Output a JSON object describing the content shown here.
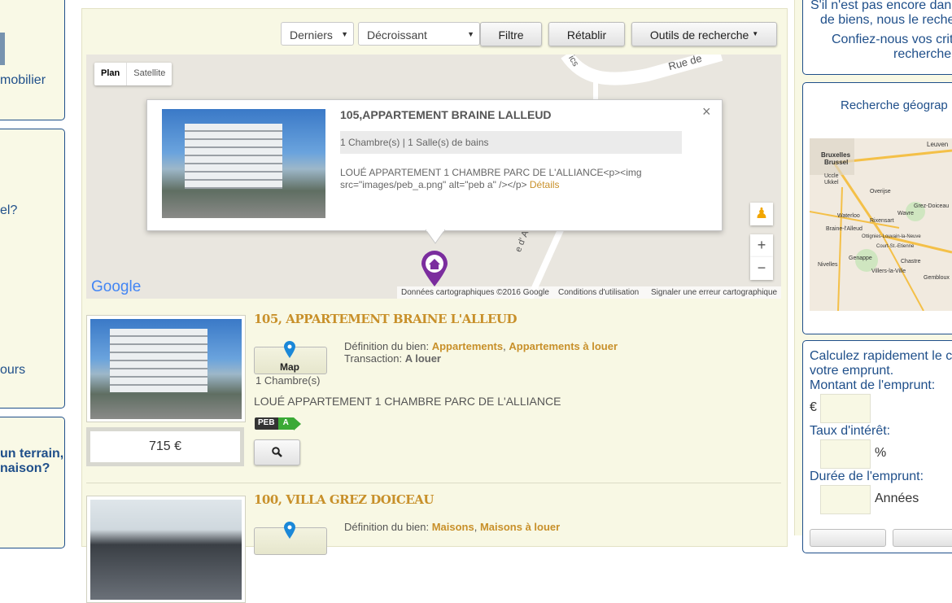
{
  "left_sidebar": {
    "link1": "mobilier",
    "link2": "el?",
    "link3": "ours",
    "heading_line1": "un terrain,",
    "heading_line2": "naison?"
  },
  "toolbar": {
    "sort_field": "Derniers",
    "sort_order": "Décroissant",
    "filter_label": "Filtre",
    "reset_label": "Rétablir",
    "tools_label": "Outils de recherche"
  },
  "map": {
    "type_plan": "Plan",
    "type_satellite": "Satellite",
    "street1": "Rue de",
    "street2": "ics",
    "street3": "e d' Autriche",
    "attribution": "Données cartographiques ©2016 Google",
    "terms": "Conditions d'utilisation",
    "report": "Signaler une erreur cartographique",
    "google_logo": "Google",
    "info": {
      "title": "105,APPARTEMENT BRAINE LALLEUD",
      "rooms": "1 Chambre(s) | 1 Salle(s) de bains",
      "desc_line1": "LOUÉ APPARTEMENT 1 CHAMBRE PARC DE L'ALLIANCE<p><img",
      "desc_line2": "src=\"images/peb_a.png\" alt=\"peb a\" /></p>",
      "details_link": "Détails",
      "close": "×"
    }
  },
  "listings": [
    {
      "title": "105, APPARTEMENT BRAINE L'ALLEUD",
      "map_label": "Map",
      "rooms": "1 Chambre(s)",
      "def_label": "Définition du bien:",
      "def_cat1": "Appartements",
      "def_sep": ",",
      "def_cat2": "Appartements à louer",
      "trans_label": "Transaction:",
      "trans_value": "A louer",
      "description": "LOUÉ APPARTEMENT 1 CHAMBRE PARC DE L'ALLIANCE",
      "peb_label": "PEB",
      "peb_grade": "A",
      "price": "715 €"
    },
    {
      "title": "100, VILLA GREZ DOICEAU",
      "def_label": "Définition du bien:",
      "def_cat1": "Maisons",
      "def_sep": ",",
      "def_cat2": "Maisons à louer"
    }
  ],
  "right_sidebar": {
    "line1": "S'il n'est pas encore dan",
    "line2": "de biens, nous le recher",
    "line3": "Confiez-nous vos crit",
    "line4": "recherche.",
    "geo_title": "Recherche géograp",
    "geo_map_labels": [
      "Bruxelles",
      "Brussel",
      "Leuven",
      "Uccle",
      "Ukkel",
      "Wavre",
      "Waterloo",
      "Rixensart",
      "Grez-Doiceau",
      "Overijse",
      "Braine-l'Alleud",
      "Ottignies-Louvain-la-Neuve",
      "Genappe",
      "Nivelles",
      "Chastre",
      "Gembloux",
      "Villers-la-Ville",
      "Court-St.-Etienne"
    ],
    "calc_line1": "Calculez rapidement le c",
    "calc_line2": "votre emprunt.",
    "amount_label": "Montant de l'emprunt:",
    "currency": "€",
    "rate_label": "Taux d'intérêt:",
    "percent": "%",
    "duration_label": "Durée de l'emprunt:",
    "years": "Années"
  },
  "colors": {
    "accent": "#c8902a",
    "link_blue": "#1f4f8a",
    "panel_bg": "#f8f8e4",
    "marker_purple": "#7b2d9e"
  }
}
